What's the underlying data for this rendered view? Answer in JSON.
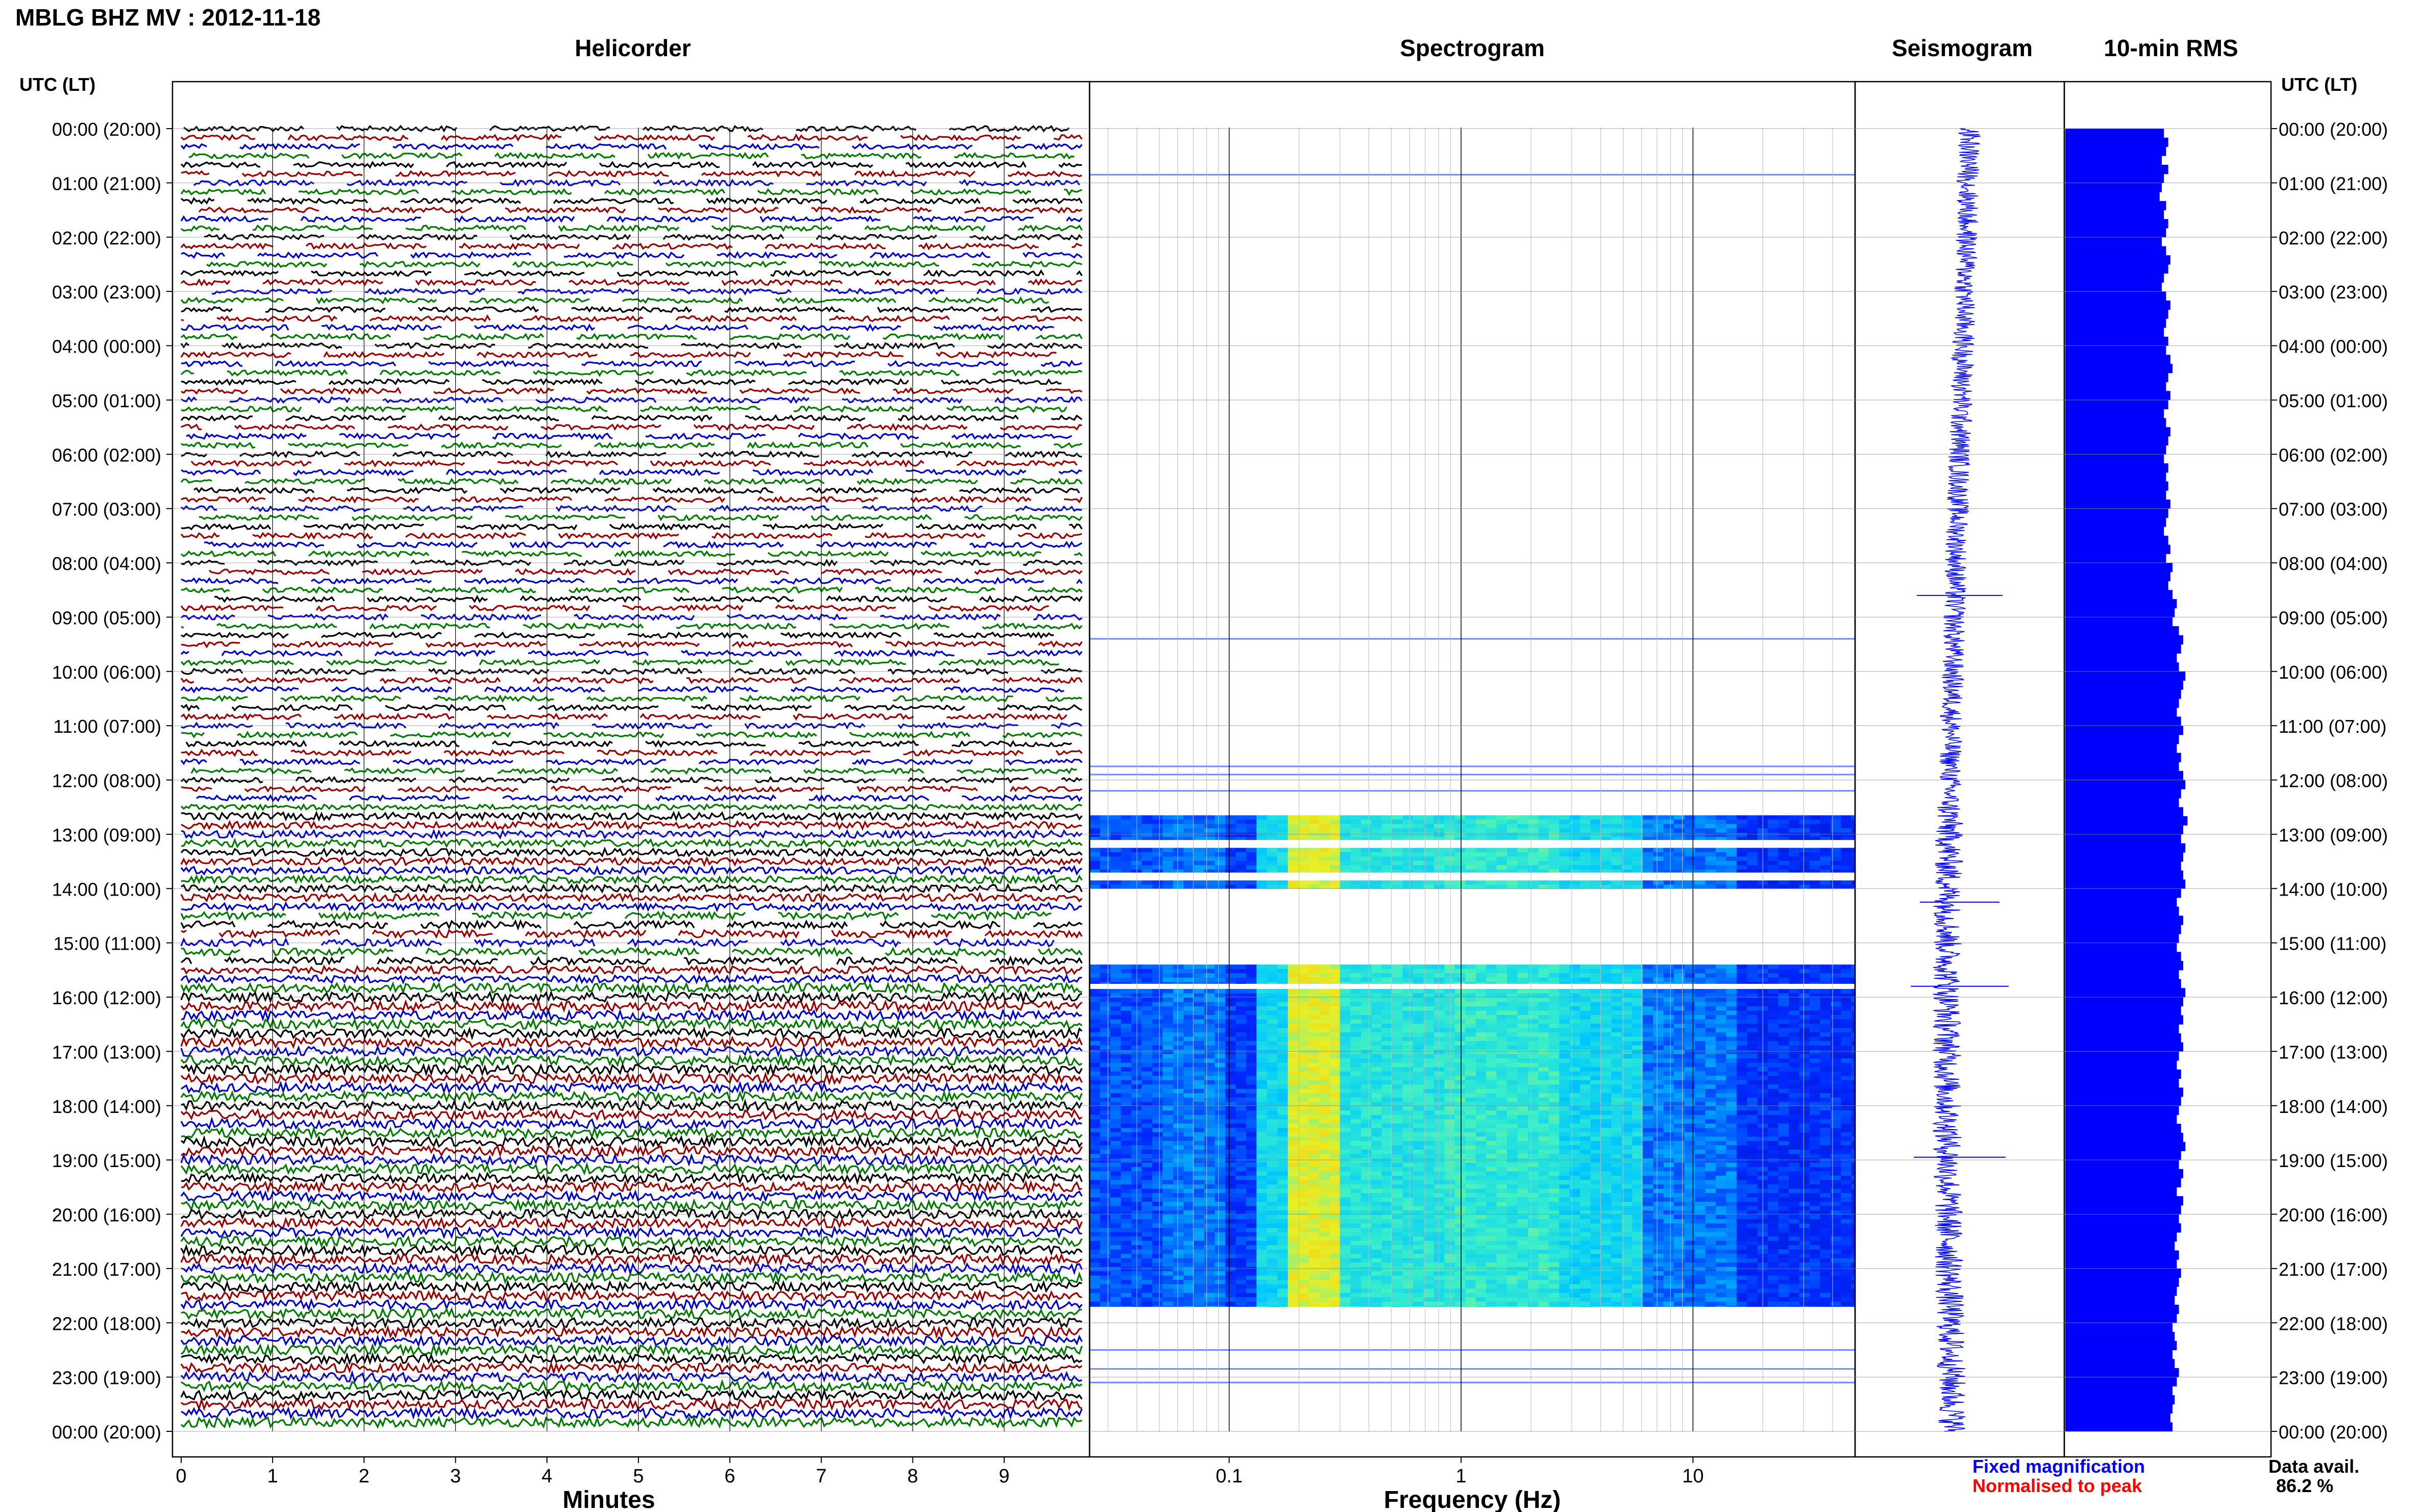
{
  "header": {
    "title": "MBLG BHZ MV : 2012-11-18"
  },
  "panels": {
    "helicorder_title": "Helicorder",
    "spectrogram_title": "Spectrogram",
    "seismogram_title": "Seismogram",
    "rms_title": "10-min RMS"
  },
  "axes": {
    "time_label_left": "UTC (LT)",
    "time_label_right": "UTC (LT)",
    "minutes_label": "Minutes",
    "frequency_label": "Frequency (Hz)",
    "minute_ticks": [
      "0",
      "1",
      "2",
      "3",
      "4",
      "5",
      "6",
      "7",
      "8",
      "9"
    ],
    "frequency_ticks": [
      "0.1",
      "1",
      "10"
    ]
  },
  "legend": {
    "fixed": "Fixed magnification",
    "normalised": "Normalised to peak",
    "data_avail_label": "Data avail.",
    "data_avail_value": "86.2 %"
  },
  "colors": {
    "helicorder_traces": [
      "#000000",
      "#9b0000",
      "#0000c8",
      "#007a00"
    ],
    "fixed_magnification": "#0000ff",
    "normalised_to_peak": "#ff0000",
    "rms_fill": "#0000ff",
    "seismogram_trace": "#0000ff"
  },
  "chart_data": {
    "type": "heatmap",
    "time_ticks": [
      "00:00 (20:00)",
      "01:00 (21:00)",
      "02:00 (22:00)",
      "03:00 (23:00)",
      "04:00 (00:00)",
      "05:00 (01:00)",
      "06:00 (02:00)",
      "07:00 (03:00)",
      "08:00 (04:00)",
      "09:00 (05:00)",
      "10:00 (06:00)",
      "11:00 (07:00)",
      "12:00 (08:00)",
      "13:00 (09:00)",
      "14:00 (10:00)",
      "15:00 (11:00)",
      "16:00 (12:00)",
      "17:00 (13:00)",
      "18:00 (14:00)",
      "19:00 (15:00)",
      "20:00 (16:00)",
      "21:00 (17:00)",
      "22:00 (18:00)",
      "23:00 (19:00)",
      "00:00 (20:00)"
    ],
    "helicorder": {
      "x_range_minutes": [
        0,
        10
      ],
      "lines_per_hour": 6,
      "gappy_until_hour": 12.5,
      "gappy_hours_extra": [
        [
          14.5,
          15.4
        ]
      ]
    },
    "spectrogram": {
      "x_scale": "log",
      "x_range_hz": [
        0.025,
        50
      ],
      "strong_bands_hours": [
        [
          12.65,
          13.1
        ],
        [
          13.25,
          13.7
        ],
        [
          13.85,
          14.0
        ],
        [
          15.4,
          15.75
        ],
        [
          15.85,
          21.7
        ]
      ],
      "faint_lines_hours": [
        0.85,
        9.4,
        11.75,
        11.9,
        12.2,
        22.5,
        22.85,
        23.1
      ]
    },
    "seismogram": {
      "spikes_hours": [
        [
          8.6,
          1.4
        ],
        [
          14.25,
          1.3
        ],
        [
          15.8,
          1.6
        ],
        [
          18.95,
          1.5
        ]
      ]
    },
    "rms_10min": {
      "values": [
        0.46,
        0.48,
        0.47,
        0.45,
        0.48,
        0.46,
        0.45,
        0.44,
        0.47,
        0.46,
        0.48,
        0.47,
        0.45,
        0.47,
        0.49,
        0.48,
        0.46,
        0.45,
        0.47,
        0.49,
        0.48,
        0.47,
        0.46,
        0.48,
        0.47,
        0.49,
        0.5,
        0.48,
        0.47,
        0.49,
        0.48,
        0.46,
        0.47,
        0.49,
        0.48,
        0.47,
        0.46,
        0.48,
        0.47,
        0.48,
        0.47,
        0.49,
        0.48,
        0.47,
        0.46,
        0.48,
        0.49,
        0.47,
        0.5,
        0.49,
        0.48,
        0.5,
        0.52,
        0.51,
        0.5,
        0.53,
        0.55,
        0.54,
        0.52,
        0.53,
        0.56,
        0.55,
        0.54,
        0.53,
        0.52,
        0.54,
        0.55,
        0.53,
        0.52,
        0.54,
        0.53,
        0.55,
        0.56,
        0.54,
        0.53,
        0.55,
        0.57,
        0.55,
        0.54,
        0.56,
        0.55,
        0.54,
        0.55,
        0.56,
        0.54,
        0.52,
        0.53,
        0.55,
        0.54,
        0.53,
        0.52,
        0.54,
        0.55,
        0.53,
        0.54,
        0.56,
        0.55,
        0.54,
        0.55,
        0.53,
        0.54,
        0.55,
        0.53,
        0.52,
        0.54,
        0.53,
        0.55,
        0.54,
        0.53,
        0.52,
        0.54,
        0.55,
        0.56,
        0.54,
        0.53,
        0.55,
        0.54,
        0.52,
        0.55,
        0.54,
        0.53,
        0.54,
        0.52,
        0.51,
        0.53,
        0.52,
        0.54,
        0.53,
        0.52,
        0.51,
        0.53,
        0.52,
        0.5,
        0.51,
        0.52,
        0.5,
        0.51,
        0.53,
        0.52,
        0.5,
        0.51,
        0.5,
        0.49,
        0.5
      ]
    }
  }
}
